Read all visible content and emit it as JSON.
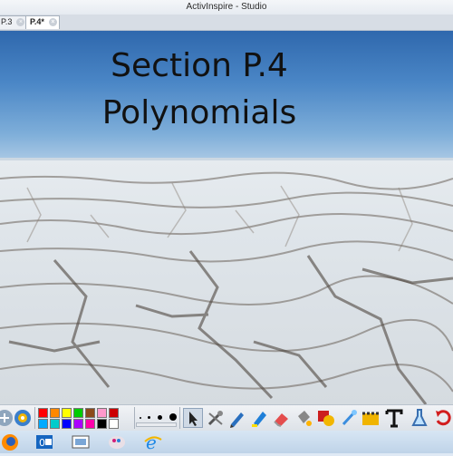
{
  "window": {
    "title": "ActivInspire - Studio"
  },
  "tabs": [
    {
      "label": "P.3"
    },
    {
      "label": "P.4*"
    }
  ],
  "slide": {
    "title_line1": "Section P.4",
    "title_line2": "Polynomials"
  },
  "toolbox": {
    "palette_colors": [
      "#ff0000",
      "#ff8800",
      "#ffff00",
      "#00cc00",
      "#8b4a1a",
      "#ff99cc",
      "#cc0000",
      "#00aaff",
      "#00cccc",
      "#0000ff",
      "#aa00ff",
      "#ff00aa",
      "#000000",
      "#ffffff"
    ],
    "tools": [
      "select-tool-icon",
      "pen-tool-icon",
      "highlighter-icon",
      "eraser-icon",
      "fill-icon",
      "shape-icon",
      "magic-ink-icon",
      "clip-art-icon",
      "text-tool-icon",
      "lab-flask-icon",
      "undo-icon"
    ]
  },
  "taskbar": {
    "apps": [
      "firefox-icon",
      "outlook-icon",
      "presentation-icon",
      "paint-icon",
      "internet-explorer-icon"
    ]
  }
}
